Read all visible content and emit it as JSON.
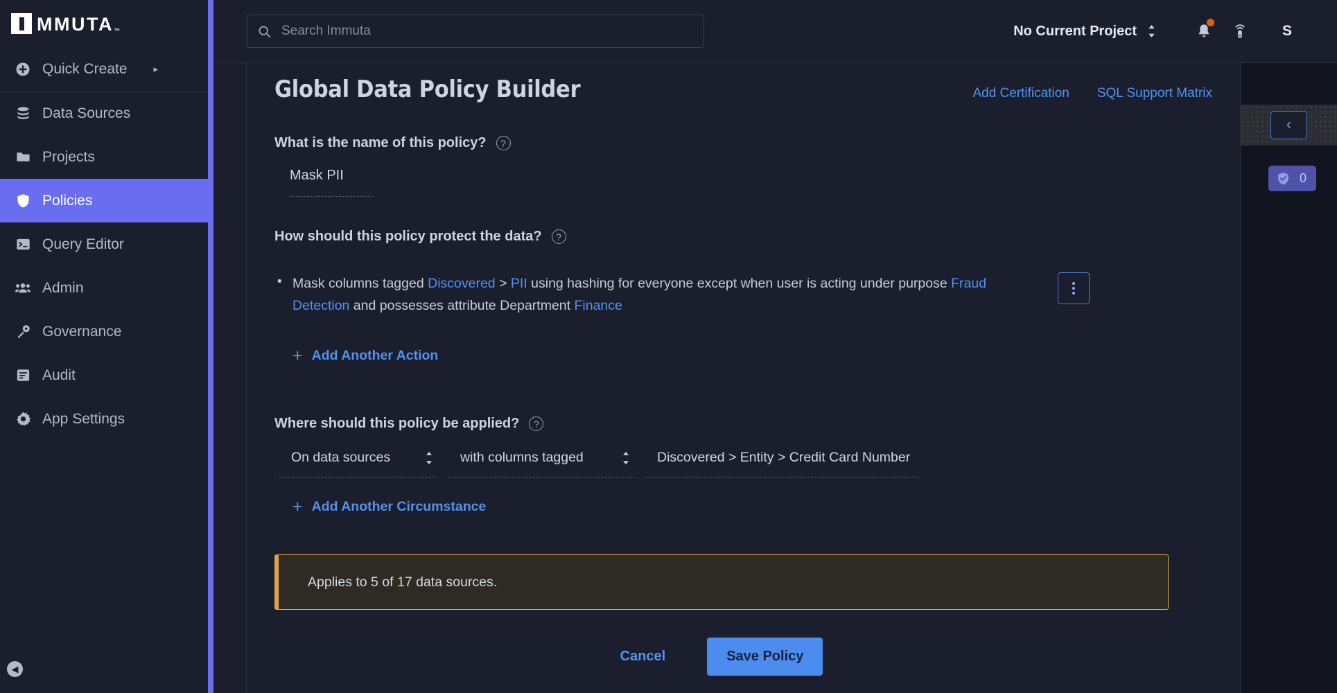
{
  "brand": {
    "logo_text": "MMUTA",
    "logo_tm": "™"
  },
  "colors": {
    "accent_purple": "#6a6df0",
    "link_blue": "#5193f0",
    "primary_button": "#4c8cef",
    "warning_border": "#e2a33c",
    "notification_dot": "#e1600f"
  },
  "sidebar": {
    "quick_create": {
      "label": "Quick Create",
      "icon": "plus-circle-icon",
      "caret": "▸"
    },
    "items": [
      {
        "label": "Data Sources",
        "icon": "database-icon",
        "active": false
      },
      {
        "label": "Projects",
        "icon": "folder-icon",
        "active": false
      },
      {
        "label": "Policies",
        "icon": "shield-icon",
        "active": true
      },
      {
        "label": "Query Editor",
        "icon": "terminal-icon",
        "active": false
      },
      {
        "label": "Admin",
        "icon": "users-icon",
        "active": false
      },
      {
        "label": "Governance",
        "icon": "key-icon",
        "active": false
      },
      {
        "label": "Audit",
        "icon": "document-list-icon",
        "active": false
      },
      {
        "label": "App Settings",
        "icon": "gear-icon",
        "active": false
      }
    ],
    "collapse_icon": "collapse-left-arrow-icon"
  },
  "topbar": {
    "search_placeholder": "Search Immuta",
    "search_value": "",
    "search_icon": "search-icon",
    "project_selector": "No Current Project",
    "project_caret_icon": "updown-chevron-icon",
    "notifications_icon": "bell-icon",
    "has_notification": true,
    "connection_icon": "signal-tower-icon",
    "avatar_letter": "S"
  },
  "main": {
    "title": "Global Data Policy Builder",
    "header_links": [
      {
        "label": "Add Certification"
      },
      {
        "label": "SQL Support Matrix"
      }
    ],
    "name_section": {
      "question": "What is the name of this policy?",
      "help_icon": "question-mark-icon",
      "value": "Mask PII",
      "placeholder": "Mask PII"
    },
    "protect_section": {
      "question": "How should this policy protect the data?",
      "help_icon": "question-mark-icon",
      "action": {
        "p1": "Mask columns tagged ",
        "tag1": "Discovered",
        "sep1": " > ",
        "tag2": "PII",
        "p2": " using hashing for everyone except when user is acting under purpose ",
        "tag3": "Fraud Detection",
        "p3": " and possesses attribute Department ",
        "tag4": "Finance"
      },
      "kebab_icon": "more-vertical-icon",
      "add_link": {
        "plus": "+",
        "label": "Add Another Action"
      }
    },
    "where_section": {
      "question": "Where should this policy be applied?",
      "help_icon": "question-mark-icon",
      "selects": [
        {
          "name": "scope-select",
          "value": "On data sources",
          "caret_icon": "updown-chevron-icon"
        },
        {
          "name": "condition-select",
          "value": "with columns tagged",
          "caret_icon": "updown-chevron-icon"
        },
        {
          "name": "tag-select",
          "value": "Discovered > Entity > Credit Card Number"
        }
      ],
      "add_link": {
        "plus": "+",
        "label": "Add Another Circumstance"
      }
    },
    "banner": {
      "text": "Applies to 5 of 17 data sources."
    },
    "footer": {
      "cancel_label": "Cancel",
      "save_label": "Save Policy"
    }
  },
  "right_panel": {
    "collapse_icon": "chevron-left-icon",
    "badge": {
      "icon": "shield-check-icon",
      "count": "0"
    }
  }
}
